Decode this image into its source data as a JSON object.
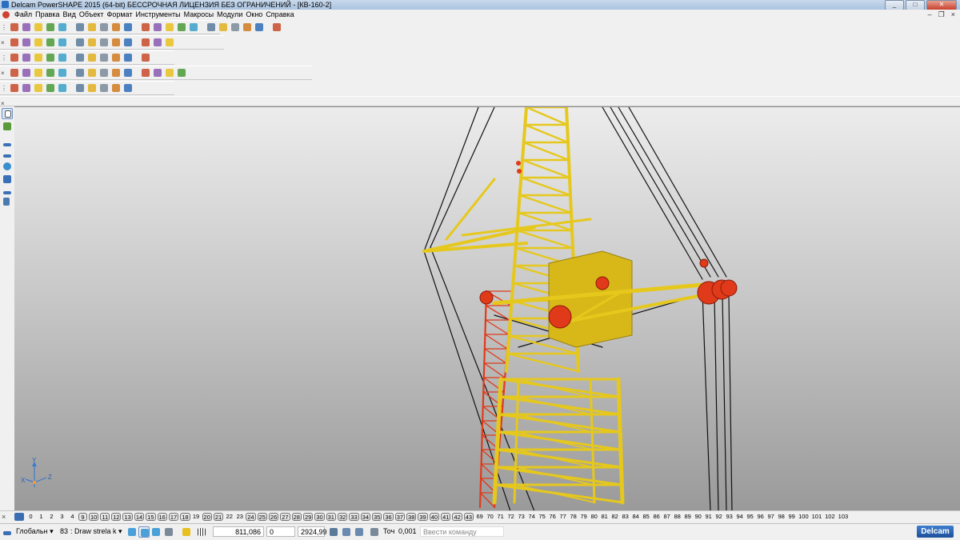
{
  "window": {
    "title": "Delcam PowerSHAPE 2015 (64-bit) БЕССРОЧНАЯ ЛИЦЕНЗИЯ БЕЗ ОГРАНИЧЕНИЙ - [КВ-160-2]",
    "minimize": "_",
    "maximize": "□",
    "close": "✕"
  },
  "menu": {
    "items": [
      "Файл",
      "Правка",
      "Вид",
      "Объект",
      "Формат",
      "Инструменты",
      "Макросы",
      "Модули",
      "Окно",
      "Справка"
    ],
    "mdi_minimize": "–",
    "mdi_restore": "❐",
    "mdi_close": "×"
  },
  "axis_triad": {
    "x": "X",
    "y": "Y",
    "z": "Z"
  },
  "levels": {
    "numbers": [
      "0",
      "1",
      "2",
      "3",
      "4",
      "9",
      "10",
      "11",
      "12",
      "13",
      "14",
      "15",
      "16",
      "17",
      "18",
      "19",
      "20",
      "21",
      "22",
      "23",
      "24",
      "25",
      "26",
      "27",
      "28",
      "29",
      "30",
      "31",
      "32",
      "33",
      "34",
      "35",
      "36",
      "37",
      "38",
      "39",
      "40",
      "41",
      "42",
      "43",
      "69",
      "70",
      "71",
      "72",
      "73",
      "74",
      "75",
      "76",
      "77",
      "78",
      "79",
      "80",
      "81",
      "82",
      "83",
      "84",
      "85",
      "86",
      "87",
      "88",
      "89",
      "90",
      "91",
      "92",
      "93",
      "94",
      "95",
      "96",
      "97",
      "98",
      "99",
      "100",
      "101",
      "102",
      "103"
    ],
    "boxed": [
      "9",
      "10",
      "11",
      "12",
      "13",
      "14",
      "15",
      "16",
      "17",
      "18",
      "20",
      "21",
      "24",
      "25",
      "26",
      "27",
      "28",
      "29",
      "30",
      "31",
      "32",
      "33",
      "34",
      "35",
      "36",
      "37",
      "38",
      "39",
      "40",
      "41",
      "42",
      "43"
    ]
  },
  "status": {
    "workplane": "Глобальн",
    "level_number": "83",
    "level_name": ": Draw strela k",
    "coord_x": "811,086",
    "coord_y": "0",
    "coord_z": "2924,99",
    "tolerance_label": "Точ",
    "tolerance_value": "0,001",
    "command_placeholder": "Ввести команду",
    "brand": "Delcam"
  },
  "colors": {
    "tower_yellow": "#e6c81c",
    "boom_red": "#e03a1a",
    "cable": "#111111",
    "viewport_top": "#ececec",
    "viewport_bottom": "#9a9a9a"
  },
  "icons": {
    "toolbar1": [
      "new-icon",
      "open-icon",
      "save-icon",
      "print-icon",
      "cut-icon",
      "copy-icon",
      "paste-icon",
      "delete-icon",
      "undo-icon",
      "redo-icon",
      "wireframe-icon",
      "line-icon",
      "arc-icon",
      "circle-icon",
      "curve-icon",
      "text-icon",
      "surface-icon",
      "solid-icon",
      "symbol-icon",
      "dimension-icon",
      "tool-icon"
    ],
    "toolbar2": [
      "view-top-icon",
      "view-front-icon",
      "view-side-icon",
      "view-iso-icon",
      "zoom-in-icon",
      "zoom-out-icon",
      "zoom-fit-icon",
      "zoom-box-icon",
      "rotate-icon",
      "shade-icon",
      "render-icon",
      "light-icon",
      "hand-icon"
    ],
    "toolbar3": [
      "select-icon",
      "doc-icon",
      "edit-icon",
      "shading-icon",
      "material-icon",
      "sphere-icon",
      "arrow-icon",
      "cube-icon",
      "box-icon",
      "link-icon",
      "export-icon"
    ],
    "toolbar4": [
      "solid-feature-icon",
      "extrude-icon",
      "revolve-icon",
      "sweep-icon",
      "blend-icon",
      "cut-feature-icon",
      "boolean-icon",
      "fillet-icon",
      "chamfer-icon",
      "shell-icon",
      "draft-icon",
      "offset-icon",
      "mirror-icon",
      "pattern-icon"
    ],
    "toolbar5": [
      "assembly-icon",
      "component-icon",
      "constraint-icon",
      "mate-icon",
      "insert-icon",
      "replace-icon",
      "explode-icon",
      "bom-icon",
      "clash-icon",
      "motion-icon"
    ]
  }
}
